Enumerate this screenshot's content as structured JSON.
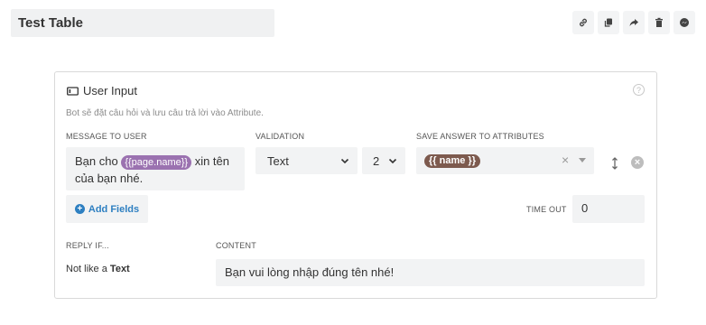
{
  "page": {
    "title": "Test Table"
  },
  "toolbar": {
    "icons": [
      "link-icon",
      "copy-icon",
      "share-icon",
      "trash-icon",
      "messenger-icon"
    ]
  },
  "card": {
    "title": "User Input",
    "description": "Bot sẽ đặt câu hỏi và lưu câu trả lời vào Attribute.",
    "labels": {
      "message": "MESSAGE TO USER",
      "validation": "VALIDATION",
      "save_answer": "SAVE ANSWER TO ATTRIBUTES",
      "timeout": "TIME OUT",
      "reply_if": "REPLY IF...",
      "content": "CONTENT"
    },
    "message": {
      "prefix": "Bạn cho",
      "variable": "{{page.name}}",
      "suffix": " xin tên của bạn nhé."
    },
    "validation": {
      "type": "Text",
      "count": "2"
    },
    "attribute": {
      "tag": "{{ name }}"
    },
    "add_fields_label": "Add Fields",
    "timeout_value": "0",
    "reply": {
      "prefix": "Not like a",
      "type": "Text"
    },
    "content_value": "Bạn vui lòng nhập đúng tên nhé!"
  },
  "colors": {
    "accent": "#2d7fc1",
    "variable_tag": "#9b72b0",
    "attribute_tag": "#7d5a4e"
  }
}
